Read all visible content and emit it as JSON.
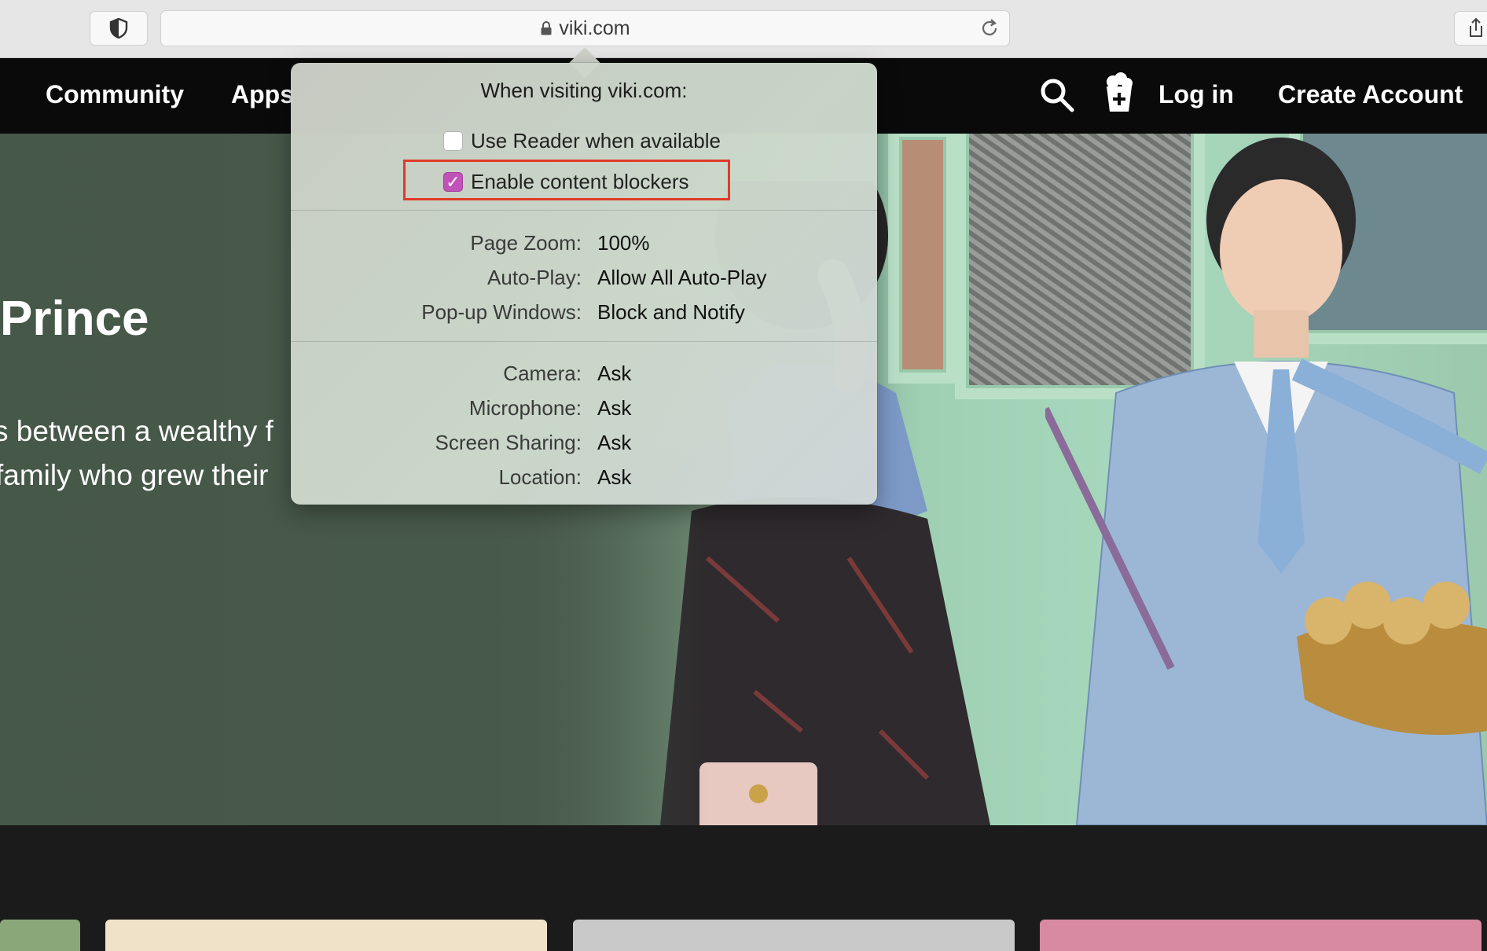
{
  "browser": {
    "url": "viki.com",
    "icons": {
      "privacy": "shield-icon",
      "lock": "lock-icon",
      "reload": "reload-icon",
      "share": "share-icon"
    }
  },
  "nav": {
    "community": "Community",
    "apps": "Apps",
    "login": "Log in",
    "create_account": "Create Account",
    "icons": {
      "search": "search-icon",
      "popcorn": "popcorn-icon"
    }
  },
  "hero": {
    "title": "Prince",
    "desc_line1": "s between a wealthy f",
    "desc_line2": "family who grew their"
  },
  "popover": {
    "title": "When visiting viki.com:",
    "reader": {
      "label": "Use Reader when available",
      "checked": false
    },
    "blockers": {
      "label": "Enable content blockers",
      "checked": true
    },
    "settings1": [
      {
        "label": "Page Zoom:",
        "value": "100%"
      },
      {
        "label": "Auto-Play:",
        "value": "Allow All Auto-Play"
      },
      {
        "label": "Pop-up Windows:",
        "value": "Block and Notify"
      }
    ],
    "settings2": [
      {
        "label": "Camera:",
        "value": "Ask"
      },
      {
        "label": "Microphone:",
        "value": "Ask"
      },
      {
        "label": "Screen Sharing:",
        "value": "Ask"
      },
      {
        "label": "Location:",
        "value": "Ask"
      }
    ]
  },
  "colors": {
    "checkbox_accent": "#c153b8",
    "highlight_border": "#e03a2a",
    "nav_background": "#0a0a0a"
  }
}
